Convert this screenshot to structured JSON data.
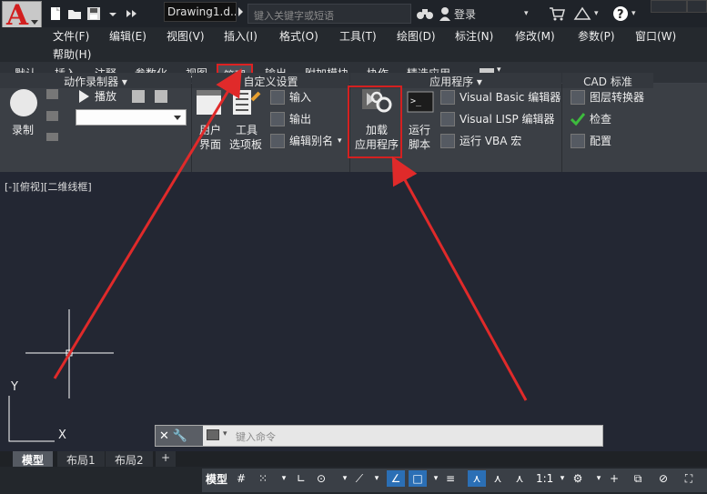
{
  "titlebar": {
    "doc_title": "Drawing1.d...",
    "search_placeholder": "键入关键字或短语",
    "login_label": "登录"
  },
  "menu": {
    "items": [
      "文件(F)",
      "编辑(E)",
      "视图(V)",
      "插入(I)",
      "格式(O)",
      "工具(T)",
      "绘图(D)",
      "标注(N)",
      "修改(M)",
      "参数(P)",
      "窗口(W)"
    ],
    "help": "帮助(H)"
  },
  "ribbon_tabs": {
    "items": [
      "默认",
      "插入",
      "注释",
      "参数化",
      "视图",
      "管理",
      "输出",
      "附加模块",
      "协作",
      "精选应用"
    ],
    "active": "管理"
  },
  "ribbon": {
    "action_recorder": {
      "record": "录制",
      "play": "播放",
      "title": "动作录制器"
    },
    "customization": {
      "user_interface": [
        "用户",
        "界面"
      ],
      "tool_palettes": [
        "工具",
        "选项板"
      ],
      "import": "输入",
      "export": "输出",
      "edit_aliases": "编辑别名",
      "title": "自定义设置"
    },
    "applications": {
      "load_app": [
        "加载",
        "应用程序"
      ],
      "run_script": [
        "运行",
        "脚本"
      ],
      "vba_editor": "Visual Basic 编辑器",
      "lisp_editor": "Visual LISP 编辑器",
      "run_vba": "运行 VBA 宏",
      "title": "应用程序"
    },
    "cad_standards": {
      "layer_translator": "图层转换器",
      "check": "检查",
      "configure": "配置",
      "title": "CAD 标准"
    }
  },
  "viewport": {
    "label": "[-][俯视][二维线框]",
    "ucs_x": "X",
    "ucs_y": "Y"
  },
  "command_line": {
    "placeholder": "键入命令"
  },
  "layout_tabs": [
    "模型",
    "布局1",
    "布局2"
  ],
  "status_bar": {
    "model": "模型",
    "scale": "1:1"
  },
  "colors": {
    "highlight_red": "#d42020",
    "arrow_red": "#e02a2a",
    "canvas_bg": "#232733",
    "ribbon_bg": "#3b3f45"
  }
}
